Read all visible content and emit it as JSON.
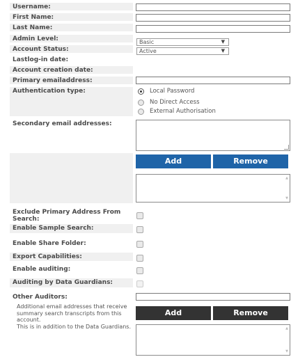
{
  "fields": {
    "username": "Username:",
    "first_name": "First Name:",
    "last_name": "Last Name:",
    "admin_level": "Admin Level:",
    "account_status": "Account Status:",
    "last_login": "Lastlog-in date:",
    "account_creation": "Account creation date:",
    "primary_email": "Primary emailaddress:",
    "auth_type": "Authentication type:",
    "secondary_emails": "Secondary email addresses:",
    "exclude_primary": "Exclude Primary Address From Search:",
    "enable_sample_search": "Enable Sample Search:",
    "enable_share_folder": "Enable Share Folder:",
    "export_capabilities": "Export Capabilities:",
    "enable_auditing": "Enable auditing:",
    "auditing_guardians": "Auditing by Data Guardians:",
    "other_auditors": "Other Auditors:"
  },
  "selects": {
    "admin_level_value": "Basic",
    "account_status_value": "Active"
  },
  "auth_options": [
    {
      "label": "Local Password",
      "selected": true
    },
    {
      "label": "No Direct Access",
      "selected": false
    },
    {
      "label": "External Authorisation",
      "selected": false
    }
  ],
  "buttons": {
    "add_secondary": "Add",
    "remove_secondary": "Remove",
    "add_auditor": "Add",
    "remove_auditor": "Remove"
  },
  "auditors_note": "Additional email addresses that receive summary search transcripts from this account.\nThis is in addition to the Data Guardians.",
  "colors": {
    "label_bg": "#f0f0f0",
    "blue_button": "#1f64a8",
    "dark_button": "#333333"
  }
}
